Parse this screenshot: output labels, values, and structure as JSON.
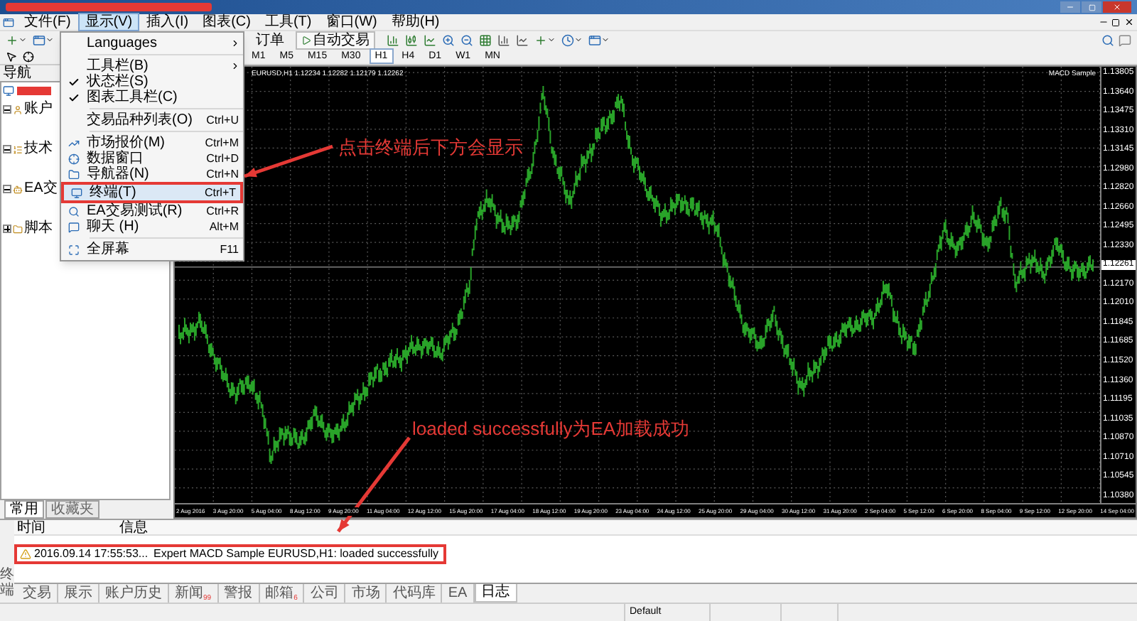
{
  "menu_bar": [
    {
      "label": "文件(F)",
      "selected": false
    },
    {
      "label": "显示(V)",
      "selected": true
    },
    {
      "label": "插入(I)",
      "selected": false
    },
    {
      "label": "图表(C)",
      "selected": false
    },
    {
      "label": "工具(T)",
      "selected": false
    },
    {
      "label": "窗口(W)",
      "selected": false
    },
    {
      "label": "帮助(H)",
      "selected": false
    }
  ],
  "toolbar": {
    "order_button": "订单",
    "autotrade_button": "自动交易",
    "timeframes": [
      {
        "label": "M1",
        "selected": false
      },
      {
        "label": "M5",
        "selected": false
      },
      {
        "label": "M15",
        "selected": false
      },
      {
        "label": "M30",
        "selected": false
      },
      {
        "label": "H1",
        "selected": true
      },
      {
        "label": "H4",
        "selected": false
      },
      {
        "label": "D1",
        "selected": false
      },
      {
        "label": "W1",
        "selected": false
      },
      {
        "label": "MN",
        "selected": false
      }
    ]
  },
  "view_menu": {
    "items": [
      {
        "kind": "submenu",
        "label": "Languages",
        "highlighted": false
      },
      {
        "kind": "separator"
      },
      {
        "kind": "submenu",
        "label": "工具栏(B)",
        "highlighted": false
      },
      {
        "kind": "check",
        "label": "状态栏(S)",
        "checked": true,
        "highlighted": false
      },
      {
        "kind": "check",
        "label": "图表工具栏(C)",
        "checked": true,
        "highlighted": false
      },
      {
        "kind": "separator"
      },
      {
        "kind": "command",
        "label": "交易品种列表(O)",
        "shortcut": "Ctrl+U",
        "highlighted": false
      },
      {
        "kind": "separator"
      },
      {
        "kind": "command",
        "label": "市场报价(M)",
        "shortcut": "Ctrl+M",
        "highlighted": false
      },
      {
        "kind": "command",
        "label": "数据窗口",
        "shortcut": "Ctrl+D",
        "highlighted": false
      },
      {
        "kind": "command",
        "label": "导航器(N)",
        "shortcut": "Ctrl+N",
        "highlighted": false
      },
      {
        "kind": "command",
        "label": "终端(T)",
        "shortcut": "Ctrl+T",
        "highlighted": true
      },
      {
        "kind": "command",
        "label": "EA交易测试(R)",
        "shortcut": "Ctrl+R",
        "highlighted": false
      },
      {
        "kind": "command",
        "label": "聊天 (H)",
        "shortcut": "Alt+M",
        "highlighted": false
      },
      {
        "kind": "separator"
      },
      {
        "kind": "command",
        "label": "全屏幕",
        "shortcut": "F11",
        "highlighted": false
      }
    ]
  },
  "navigator": {
    "title": "导航",
    "items": [
      {
        "label": "账户",
        "expanded": true
      },
      {
        "label": "技术",
        "expanded": true
      },
      {
        "label": "EA交",
        "expanded": true
      },
      {
        "label": "脚本",
        "expanded": false
      }
    ],
    "tabs": [
      {
        "label": "常用",
        "selected": true
      },
      {
        "label": "收藏夹",
        "selected": false
      }
    ]
  },
  "chart": {
    "info": "EURUSD,H1  1.12234 1.12282 1.12179 1.12262",
    "expert": "MACD Sample",
    "price_labels": [
      {
        "label": "1.13805",
        "current": false
      },
      {
        "label": "1.13640",
        "current": false
      },
      {
        "label": "1.13475",
        "current": false
      },
      {
        "label": "1.13310",
        "current": false
      },
      {
        "label": "1.13145",
        "current": false
      },
      {
        "label": "1.12980",
        "current": false
      },
      {
        "label": "1.12820",
        "current": false
      },
      {
        "label": "1.12660",
        "current": false
      },
      {
        "label": "1.12495",
        "current": false
      },
      {
        "label": "1.12330",
        "current": false
      },
      {
        "label": "1.12261",
        "current": true
      },
      {
        "label": "1.12170",
        "current": false
      },
      {
        "label": "1.12010",
        "current": false
      },
      {
        "label": "1.11845",
        "current": false
      },
      {
        "label": "1.11685",
        "current": false
      },
      {
        "label": "1.11520",
        "current": false
      },
      {
        "label": "1.11360",
        "current": false
      },
      {
        "label": "1.11195",
        "current": false
      },
      {
        "label": "1.11035",
        "current": false
      },
      {
        "label": "1.10870",
        "current": false
      },
      {
        "label": "1.10710",
        "current": false
      },
      {
        "label": "1.10545",
        "current": false
      },
      {
        "label": "1.10380",
        "current": false
      }
    ],
    "time_labels": [
      "2 Aug 2016",
      "3 Aug 20:00",
      "5 Aug 04:00",
      "8 Aug 12:00",
      "9 Aug 20:00",
      "11 Aug 04:00",
      "12 Aug 12:00",
      "15 Aug 20:00",
      "17 Aug 04:00",
      "18 Aug 12:00",
      "19 Aug 20:00",
      "23 Aug 04:00",
      "24 Aug 12:00",
      "25 Aug 20:00",
      "29 Aug 04:00",
      "30 Aug 12:00",
      "31 Aug 20:00",
      "2 Sep 04:00",
      "5 Sep 12:00",
      "6 Sep 20:00",
      "8 Sep 04:00",
      "9 Sep 12:00",
      "12 Sep 20:00",
      "14 Sep 04:00"
    ]
  },
  "annotations": [
    {
      "kind": "menu-note",
      "text": "点击终端后下方会显示"
    },
    {
      "kind": "log-note",
      "text": "loaded successfully为EA加载成功"
    }
  ],
  "terminal": {
    "side_label": "终端",
    "columns": [
      "时间",
      "信息"
    ],
    "rows": [
      {
        "time": "2016.09.14 17:55:53...",
        "message": "Expert MACD Sample EURUSD,H1: loaded successfully",
        "highlighted": true
      }
    ],
    "tabs": [
      {
        "label": "交易",
        "selected": false
      },
      {
        "label": "展示",
        "selected": false
      },
      {
        "label": "账户历史",
        "selected": false
      },
      {
        "label": "新闻",
        "badge": "99",
        "selected": false
      },
      {
        "label": "警报",
        "selected": false
      },
      {
        "label": "邮箱",
        "badge": "6",
        "selected": false
      },
      {
        "label": "公司",
        "selected": false
      },
      {
        "label": "市场",
        "selected": false
      },
      {
        "label": "代码库",
        "selected": false
      },
      {
        "label": "EA",
        "selected": false
      },
      {
        "label": "日志",
        "selected": true
      }
    ]
  },
  "status_bar": {
    "fields": [
      "Default"
    ]
  }
}
